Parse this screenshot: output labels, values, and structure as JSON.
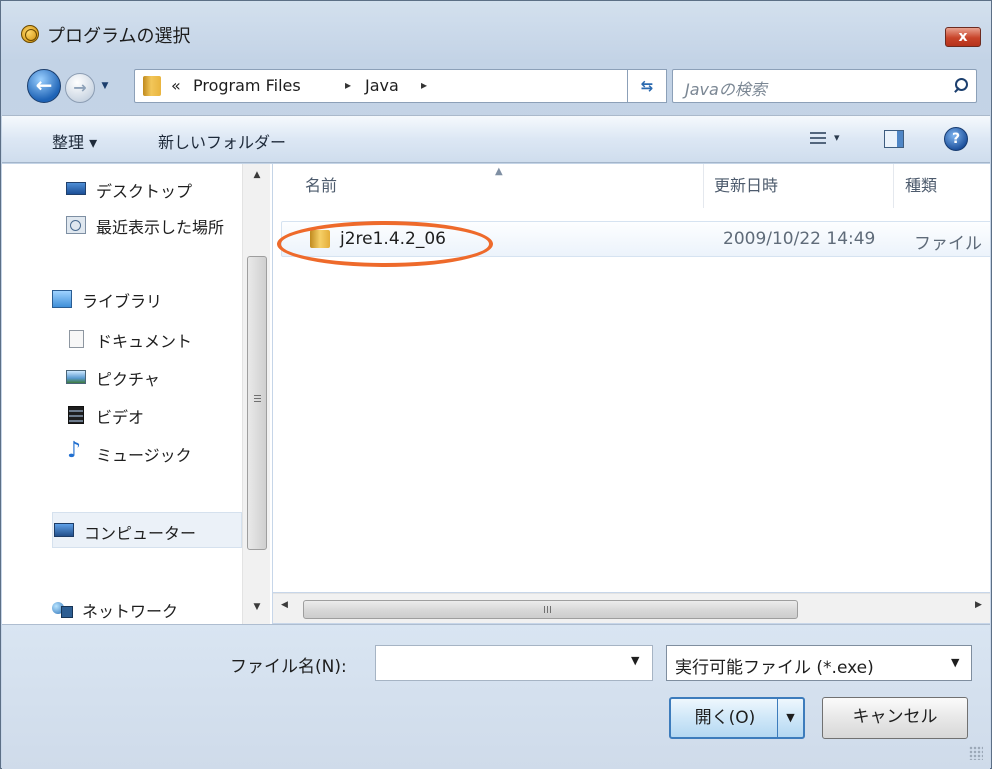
{
  "window": {
    "title": "プログラムの選択",
    "close_label": "x"
  },
  "address": {
    "overflow": "«",
    "crumbs": [
      "Program Files",
      "Java"
    ],
    "separator": "▸",
    "dropdown": "▾",
    "refresh": "⇆"
  },
  "search": {
    "placeholder": "Javaの検索"
  },
  "toolbar": {
    "organize": "整理 ▾",
    "new_folder": "新しいフォルダー",
    "views_arrow": "▾",
    "help": "?"
  },
  "nav": {
    "items": [
      {
        "label": "デスクトップ",
        "icon": "desktop-icon"
      },
      {
        "label": "最近表示した場所",
        "icon": "recent-places-icon"
      },
      {
        "label": "ライブラリ",
        "icon": "library-icon"
      },
      {
        "label": "ドキュメント",
        "icon": "documents-icon"
      },
      {
        "label": "ピクチャ",
        "icon": "pictures-icon"
      },
      {
        "label": "ビデオ",
        "icon": "videos-icon"
      },
      {
        "label": "ミュージック",
        "icon": "music-icon"
      },
      {
        "label": "コンピューター",
        "icon": "computer-icon"
      },
      {
        "label": "ネットワーク",
        "icon": "network-icon"
      }
    ]
  },
  "columns": {
    "name": "名前",
    "modified": "更新日時",
    "type": "種類"
  },
  "files": [
    {
      "name": "j2re1.4.2_06",
      "modified": "2009/10/22 14:49",
      "type": "ファイル"
    }
  ],
  "highlight_color": "#ee6a2b",
  "bottom": {
    "filename_label": "ファイル名(N):",
    "filename_value": "",
    "filetype_value": "実行可能ファイル (*.exe)",
    "open_label": "開く(O)",
    "cancel_label": "キャンセル"
  }
}
